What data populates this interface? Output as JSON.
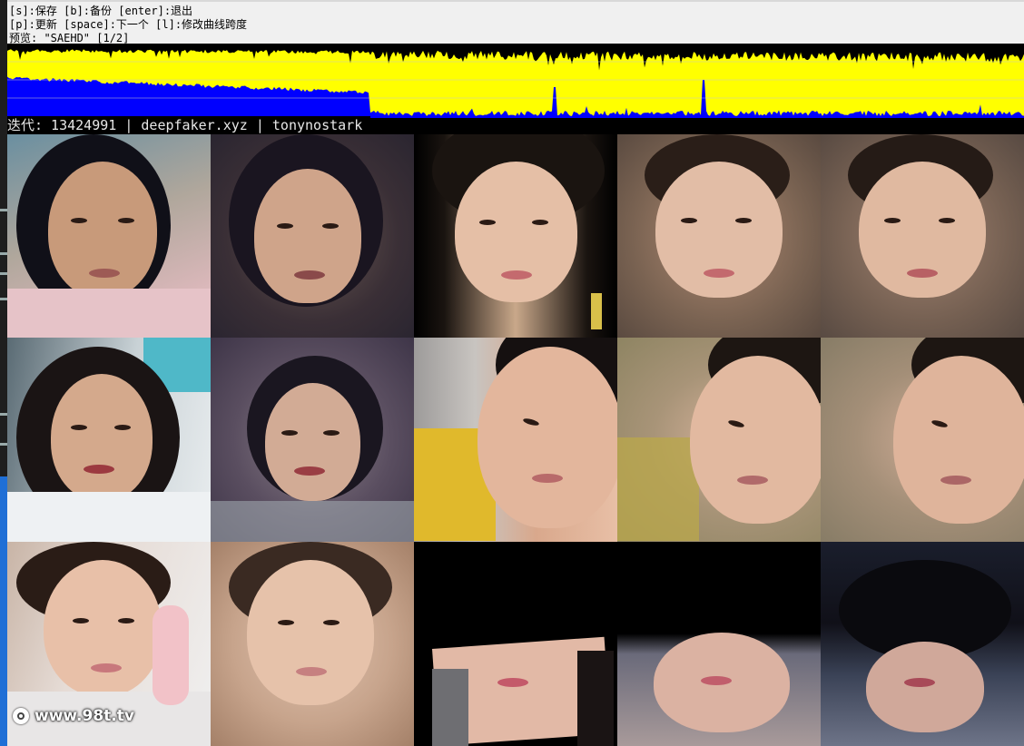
{
  "info": {
    "line1": "[s]:保存 [b]:备份 [enter]:退出",
    "line2": "[p]:更新 [space]:下一个 [l]:修改曲线跨度",
    "line3": "预览: \"SAEHD\" [1/2]"
  },
  "status": {
    "text": "迭代: 13424991 | deepfaker.xyz | tonynostark"
  },
  "loss_graph": {
    "colors": {
      "background": "#000000",
      "src_loss": "#ffff00",
      "dst_loss": "#0000ff",
      "gridline": "#c8c8c8"
    }
  },
  "preview": {
    "rows": [
      {
        "cells": [
          "src-original",
          "src-reconstructed",
          "dst-original",
          "dst-reconstructed",
          "dst-swapped"
        ]
      },
      {
        "cells": [
          "src-original",
          "src-reconstructed",
          "dst-original",
          "dst-reconstructed",
          "dst-swapped"
        ]
      },
      {
        "cells": [
          "src-original",
          "src-reconstructed",
          "dst-original",
          "dst-reconstructed",
          "dst-swapped"
        ]
      }
    ]
  },
  "watermark": {
    "text": "www.98t.tv",
    "icon": "camera-lens-icon"
  }
}
